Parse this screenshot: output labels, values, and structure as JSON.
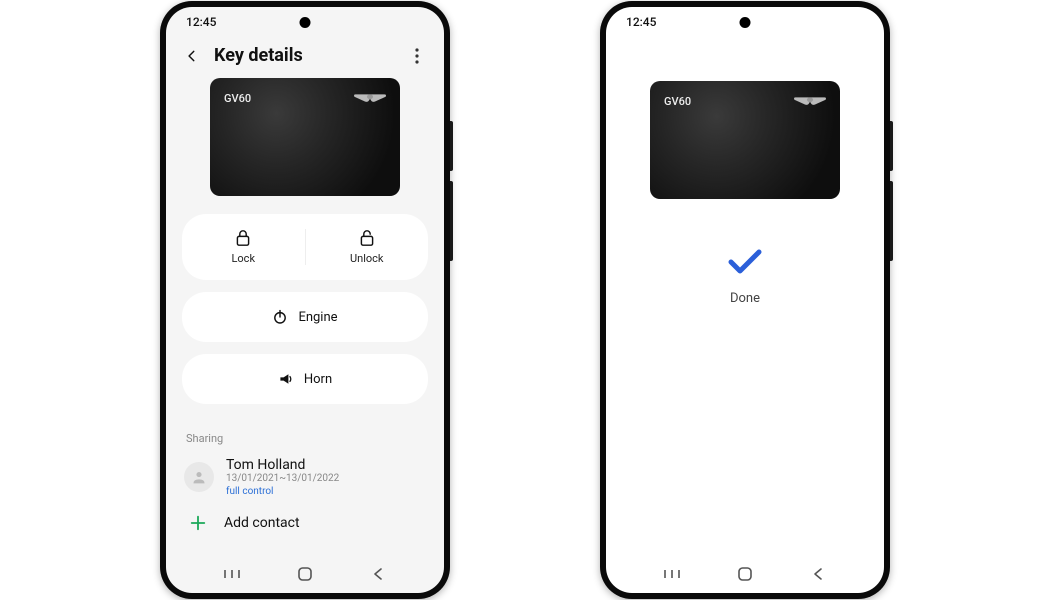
{
  "statusbar": {
    "time": "12:45"
  },
  "phone1": {
    "appbar": {
      "title": "Key details"
    },
    "card": {
      "model": "GV60"
    },
    "actions": {
      "lock": "Lock",
      "unlock": "Unlock",
      "engine": "Engine",
      "horn": "Horn"
    },
    "sharing": {
      "header": "Sharing",
      "contact": {
        "name": "Tom Holland",
        "dates": "13/01/2021~13/01/2022",
        "permission": "full control"
      },
      "add_label": "Add contact"
    }
  },
  "phone2": {
    "card": {
      "model": "GV60"
    },
    "done_label": "Done"
  },
  "colors": {
    "accent_blue": "#2b5fd9",
    "add_green": "#1aa858"
  }
}
